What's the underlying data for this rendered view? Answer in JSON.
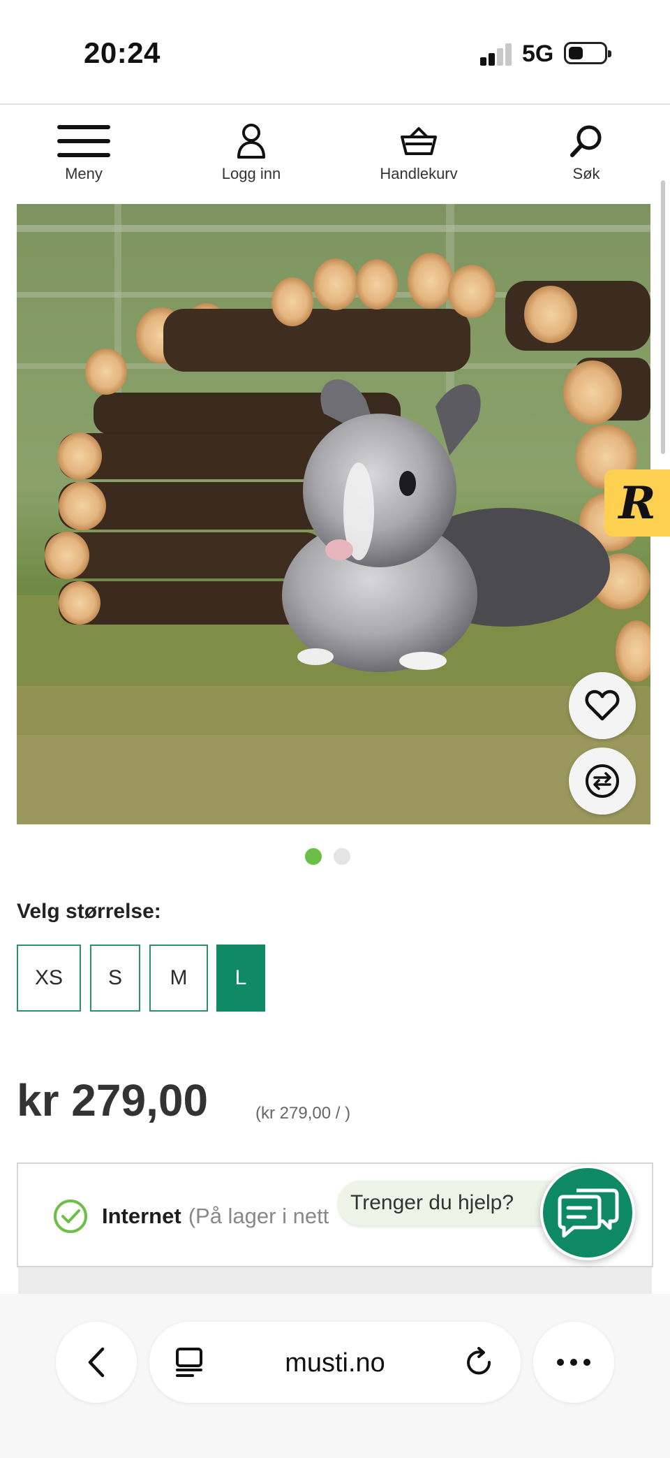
{
  "status_bar": {
    "time": "20:24",
    "network": "5G"
  },
  "nav": {
    "menu_label": "Meny",
    "login_label": "Logg inn",
    "cart_label": "Handlekurv",
    "search_label": "Søk"
  },
  "badge": {
    "letter": "R"
  },
  "gallery": {
    "image_count": 2,
    "active_index": 0
  },
  "size_selector": {
    "label": "Velg størrelse:",
    "options": [
      "XS",
      "S",
      "M",
      "L"
    ],
    "selected": "L"
  },
  "price": {
    "main": "kr 279,00",
    "unit": "(kr 279,00 / )"
  },
  "stock": {
    "channel": "Internet",
    "detail": "(På lager i nett"
  },
  "chat": {
    "prompt": "Trenger du hjelp?"
  },
  "browser": {
    "url": "musti.no"
  },
  "colors": {
    "brand_green": "#0f8a64",
    "dot_active": "#6cbf46",
    "badge_yellow": "#fdd04f"
  },
  "icons": [
    "hamburger-icon",
    "user-icon",
    "basket-icon",
    "search-icon",
    "heart-icon",
    "compare-icon",
    "check-circle-icon",
    "chat-icon",
    "back-chevron-icon",
    "reader-icon",
    "reload-icon",
    "more-dots-icon"
  ]
}
